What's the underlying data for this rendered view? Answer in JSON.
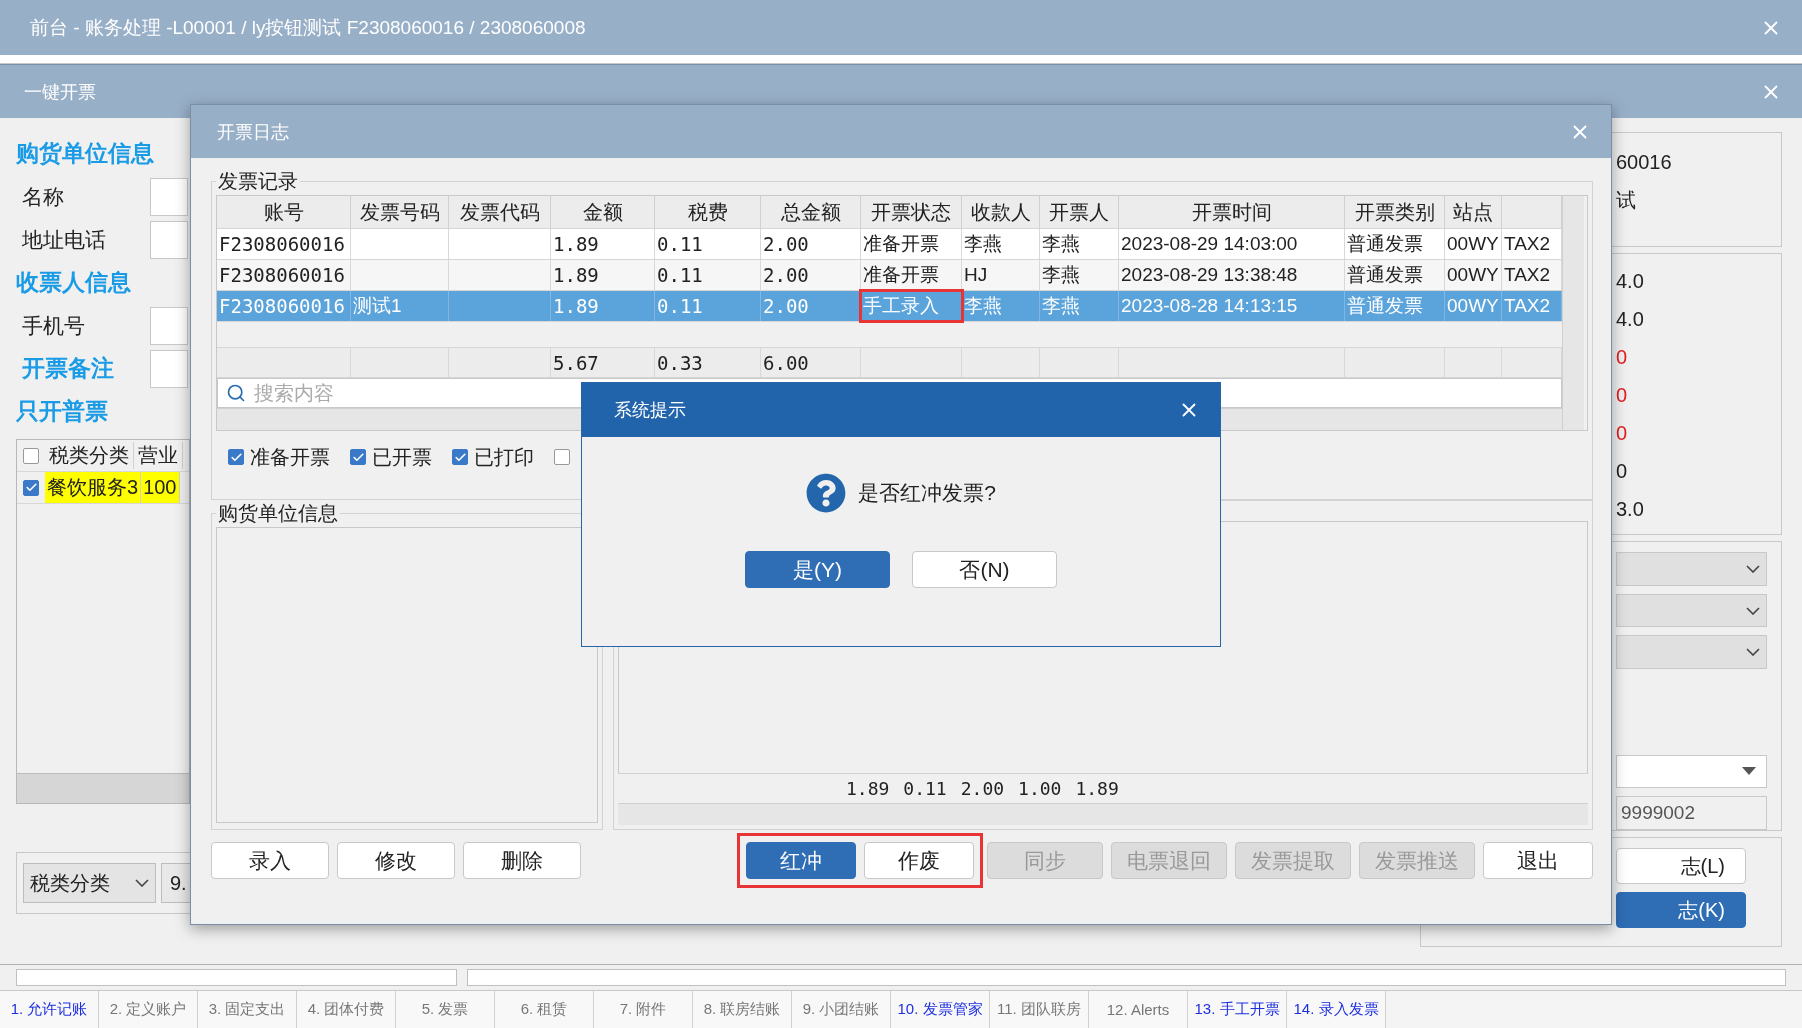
{
  "main_window": {
    "title": "前台 - 账务处理 -L00001 / ly按钮测试 F2308060016 / 2308060008"
  },
  "invoice_window": {
    "title": "一键开票",
    "left_rows": [
      {
        "kind": "heading",
        "text": "购货单位信息"
      },
      {
        "kind": "field",
        "text": "名称"
      },
      {
        "kind": "field",
        "text": "地址电话"
      },
      {
        "kind": "heading",
        "text": "收票人信息"
      },
      {
        "kind": "field",
        "text": "手机号"
      },
      {
        "kind": "heading_field",
        "text": "开票备注"
      },
      {
        "kind": "heading",
        "text": "只开普票"
      }
    ],
    "tax_table": {
      "columns": [
        "税类分类",
        "营业"
      ],
      "header_checked": false,
      "rows": [
        {
          "checked": true,
          "cells": [
            "餐饮服务3",
            "100"
          ]
        }
      ]
    },
    "tax_select": {
      "value": "税类分类"
    },
    "amount_field": {
      "value": "9."
    },
    "right_texts": [
      "60016",
      "试"
    ],
    "right_values": [
      {
        "kind": "normal",
        "text": "4.0"
      },
      {
        "kind": "normal",
        "text": "4.0"
      },
      {
        "kind": "alert",
        "text": "0"
      },
      {
        "kind": "alert",
        "text": "0"
      },
      {
        "kind": "alert",
        "text": "0"
      },
      {
        "kind": "normal",
        "text": "0"
      },
      {
        "kind": "normal",
        "text": "3.0"
      }
    ],
    "right_field": {
      "value": "9999002"
    },
    "right_buttons": [
      {
        "kind": "normal",
        "label": "志(L)"
      },
      {
        "kind": "primary",
        "label": "志(K)"
      }
    ]
  },
  "log_dialog": {
    "title": "开票日志",
    "records_group": "发票记录",
    "columns": [
      {
        "kind": "text",
        "label": "账号"
      },
      {
        "kind": "text",
        "label": "发票号码"
      },
      {
        "kind": "text",
        "label": "发票代码"
      },
      {
        "kind": "number",
        "label": "金额"
      },
      {
        "kind": "number",
        "label": "税费"
      },
      {
        "kind": "number",
        "label": "总金额"
      },
      {
        "kind": "status",
        "label": "开票状态"
      },
      {
        "kind": "text",
        "label": "收款人"
      },
      {
        "kind": "text",
        "label": "开票人"
      },
      {
        "kind": "text",
        "label": "开票时间"
      },
      {
        "kind": "text",
        "label": "开票类别"
      },
      {
        "kind": "text",
        "label": "站点"
      },
      {
        "kind": "text"
      }
    ],
    "rows": [
      {
        "selected": false,
        "status_boxed": false,
        "cells": [
          "F2308060016",
          null,
          null,
          "1.89",
          "0.11",
          "2.00",
          "准备开票",
          "李燕",
          "李燕",
          "2023-08-29 14:03:00",
          "普通发票",
          "00WY",
          "TAX2"
        ]
      },
      {
        "selected": false,
        "status_boxed": false,
        "cells": [
          "F2308060016",
          null,
          null,
          "1.89",
          "0.11",
          "2.00",
          "准备开票",
          "HJ",
          "李燕",
          "2023-08-29 13:38:48",
          "普通发票",
          "00WY",
          "TAX2"
        ]
      },
      {
        "selected": true,
        "status_boxed": true,
        "cells": [
          "F2308060016",
          "测试1",
          null,
          "1.89",
          "0.11",
          "2.00",
          "手工录入",
          "李燕",
          "李燕",
          "2023-08-28 14:13:15",
          "普通发票",
          "00WY",
          "TAX2"
        ]
      }
    ],
    "totals": [
      "5.67",
      "0.33",
      "6.00"
    ],
    "search": {
      "placeholder": "搜索内容"
    },
    "filters": [
      {
        "label": "准备开票",
        "checked": true
      },
      {
        "label": "已开票",
        "checked": true
      },
      {
        "label": "已打印",
        "checked": true
      },
      {
        "checked": false
      }
    ],
    "buyer_group": "购货单位信息",
    "summary_values": [
      "1.89",
      "0.11",
      "2.00",
      "1.00",
      "1.89"
    ],
    "button_groups": [
      {
        "boxed": false,
        "buttons": [
          {
            "kind": "normal",
            "label": "录入"
          },
          {
            "kind": "normal",
            "label": "修改"
          },
          {
            "kind": "normal",
            "label": "删除"
          }
        ]
      },
      {
        "boxed": true,
        "buttons": [
          {
            "kind": "primary",
            "label": "红冲"
          },
          {
            "kind": "normal",
            "label": "作废"
          }
        ]
      },
      {
        "boxed": false,
        "buttons": [
          {
            "kind": "disabled",
            "label": "同步"
          },
          {
            "kind": "disabled",
            "label": "电票退回"
          },
          {
            "kind": "disabled",
            "label": "发票提取"
          },
          {
            "kind": "disabled",
            "label": "发票推送"
          },
          {
            "kind": "normal",
            "label": "退出"
          }
        ]
      }
    ]
  },
  "prompt": {
    "title": "系统提示",
    "message": "是否红冲发票?",
    "buttons": [
      {
        "kind": "primary",
        "label": "是(Y)"
      },
      {
        "kind": "normal",
        "label": "否(N)"
      }
    ]
  },
  "bottom_tabs": [
    {
      "label": "1. 允许记账",
      "active": true
    },
    {
      "label": "2. 定义账户",
      "active": false
    },
    {
      "label": "3. 固定支出",
      "active": false
    },
    {
      "label": "4. 团体付费",
      "active": false
    },
    {
      "label": "5. 发票",
      "active": false
    },
    {
      "label": "6. 租赁",
      "active": false
    },
    {
      "label": "7. 附件",
      "active": false
    },
    {
      "label": "8. 联房结账",
      "active": false
    },
    {
      "label": "9. 小团结账",
      "active": false
    },
    {
      "label": "10. 发票管家",
      "active": true
    },
    {
      "label": "11. 团队联房",
      "active": false
    },
    {
      "label": "12. Alerts",
      "active": false
    },
    {
      "label": "13. 手工开票",
      "active": true
    },
    {
      "label": "14. 录入发票",
      "active": true
    }
  ]
}
